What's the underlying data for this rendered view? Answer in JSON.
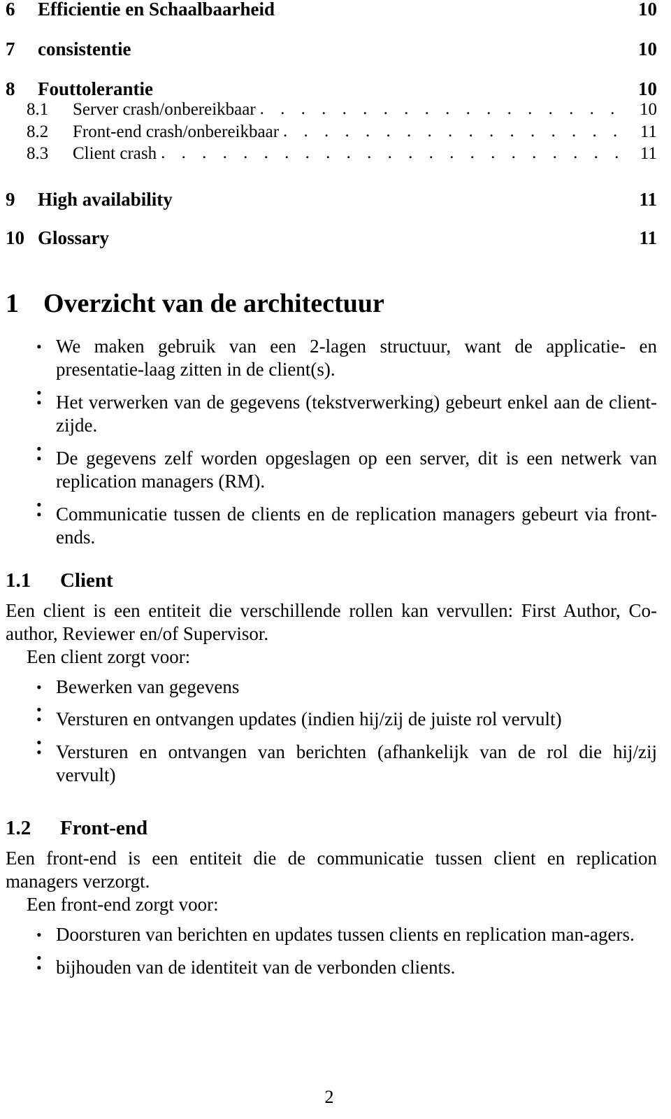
{
  "document": {
    "page_number": "2",
    "toc": {
      "entries": [
        {
          "level": 1,
          "number": "6",
          "title": "Efficientie en Schaalbaarheid",
          "page": "10"
        },
        {
          "level": 1,
          "number": "7",
          "title": "consistentie",
          "page": "10"
        },
        {
          "level": 1,
          "number": "8",
          "title": "Fouttolerantie",
          "page": "10"
        },
        {
          "level": 2,
          "number": "8.1",
          "title": "Server crash/onbereikbaar",
          "page": "10"
        },
        {
          "level": 2,
          "number": "8.2",
          "title": "Front-end crash/onbereikbaar",
          "page": "11"
        },
        {
          "level": 2,
          "number": "8.3",
          "title": "Client crash",
          "page": "11"
        },
        {
          "level": 1,
          "number": "9",
          "title": "High availability",
          "page": "11"
        },
        {
          "level": 1,
          "number": "10",
          "title": "Glossary",
          "page": "11"
        }
      ],
      "dot_leader": ". . . . . . . . . . . . . . . . . . . . . . . . . . . . . . . . . . . . . . . . . ."
    },
    "section1": {
      "number": "1",
      "title": "Overzicht van de architectuur",
      "bullets": [
        "We maken gebruik van een 2-lagen structuur, want de applicatie- en presentatie-laag zitten in de client(s).",
        "Het verwerken van de gegevens (tekstverwerking) gebeurt enkel aan de client-zijde.",
        "De gegevens zelf worden opgeslagen op een server, dit is een netwerk van replication managers (RM).",
        "Communicatie tussen de clients en de replication managers gebeurt via front-ends."
      ]
    },
    "subsection_1_1": {
      "number": "1.1",
      "title": "Client",
      "paragraph": "Een client is een entiteit die verschillende rollen kan vervullen: First Author, Co-author, Reviewer en/of Supervisor.",
      "lead_in": "Een client zorgt voor:",
      "bullets": [
        "Bewerken van gegevens",
        "Versturen en ontvangen updates (indien hij/zij de juiste rol vervult)",
        "Versturen en ontvangen van berichten (afhankelijk van de rol die hij/zij vervult)"
      ]
    },
    "subsection_1_2": {
      "number": "1.2",
      "title": "Front-end",
      "paragraph": "Een front-end is een entiteit die de communicatie tussen client en replication managers verzorgt.",
      "lead_in": "Een front-end zorgt voor:",
      "bullets": [
        "Doorsturen van berichten en updates tussen clients en replication man-agers.",
        "bijhouden van de identiteit van de verbonden clients."
      ]
    }
  }
}
